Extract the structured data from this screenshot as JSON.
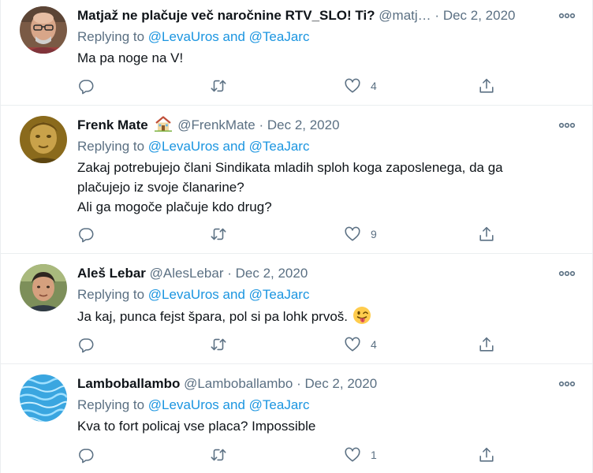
{
  "tweets": [
    {
      "name": "Matjaž ne plačuje več naročnine RTV_SLO! Ti?",
      "handle": "@matj…",
      "sep": "·",
      "date": "Dec 2, 2020",
      "reply_prefix": "Replying to",
      "mention1": "@LevaUros",
      "and": "and",
      "mention2": "@TeaJarc",
      "lines": [
        "Ma pa noge na V!"
      ],
      "like_count": "4",
      "avatar": "avatar-bald-man-glasses"
    },
    {
      "name": "Frenk Mate",
      "name_emoji": "house-icon",
      "handle": "@FrenkMate",
      "sep": "·",
      "date": "Dec 2, 2020",
      "reply_prefix": "Replying to",
      "mention1": "@LevaUros",
      "and": "and",
      "mention2": "@TeaJarc",
      "lines": [
        "Zakaj potrebujejo člani Sindikata mladih sploh koga zaposlenega, da ga",
        "plačujejo iz svoje članarine?",
        "Ali ga mogoče plačuje kdo drug?"
      ],
      "like_count": "9",
      "avatar": "avatar-man-yellow-tint"
    },
    {
      "name": "Aleš Lebar",
      "handle": "@AlesLebar",
      "sep": "·",
      "date": "Dec 2, 2020",
      "reply_prefix": "Replying to",
      "mention1": "@LevaUros",
      "and": "and",
      "mention2": "@TeaJarc",
      "lines": [
        "Ja kaj, punca fejst špara, pol si pa lohk prvoš."
      ],
      "text_emoji": "winking-face-tongue-icon",
      "like_count": "4",
      "avatar": "avatar-man-dark-hair"
    },
    {
      "name": "Lamboballambo",
      "handle": "@Lamboballambo",
      "sep": "·",
      "date": "Dec 2, 2020",
      "reply_prefix": "Replying to",
      "mention1": "@LevaUros",
      "and": "and",
      "mention2": "@TeaJarc",
      "lines": [
        "Kva to fort policaj vse placa? Impossible"
      ],
      "like_count": "1",
      "avatar": "avatar-blue-water"
    }
  ],
  "icons": {
    "reply": "reply-icon",
    "retweet": "retweet-icon",
    "like": "like-icon",
    "share": "share-icon",
    "more": "more-icon"
  },
  "colors": {
    "text": "#0f1419",
    "secondary": "#5b7083",
    "link": "#1b95e0",
    "border": "#ebeef0"
  }
}
